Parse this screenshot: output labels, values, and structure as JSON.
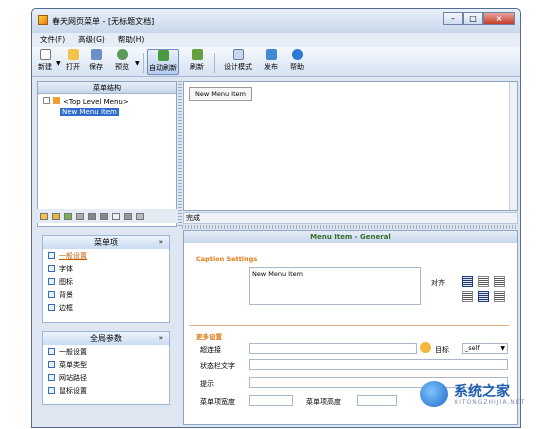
{
  "window": {
    "title": "春天网页菜单 - [无标题文档]"
  },
  "menubar": [
    "文件(F)",
    "高级(G)",
    "帮助(H)"
  ],
  "toolbar": {
    "new": "新建",
    "open": "打开",
    "save": "保存",
    "preview": "预览",
    "auto_refresh": "自动刷新",
    "refresh": "刷新",
    "design_mode": "设计模式",
    "publish": "发布",
    "help": "帮助"
  },
  "tree": {
    "header": "菜单结构",
    "root": "<Top Level Menu>",
    "item": "New Menu Item"
  },
  "design": {
    "menu_item": "New Menu Item"
  },
  "status": "完成",
  "menu_panel": {
    "title": "菜单项",
    "items": [
      "一般设置",
      "字体",
      "图标",
      "背景",
      "边框"
    ]
  },
  "global_panel": {
    "title": "全局参数",
    "items": [
      "一般设置",
      "菜单类型",
      "网站路径",
      "鼠标设置"
    ]
  },
  "props": {
    "header": "Menu Item - General",
    "caption_title": "Caption Settings",
    "caption_value": "New Menu Item",
    "align_label": "对齐",
    "more_title": "更多设置",
    "link_label": "超连接",
    "target_label": "目标",
    "target_value": "_self",
    "status_label": "状态栏文字",
    "tip_label": "提示",
    "width_label": "菜单项宽度",
    "height_label": "菜单项高度"
  },
  "watermark": {
    "text": "系统之家",
    "sub": "XITONGZHIJIA.NET"
  }
}
